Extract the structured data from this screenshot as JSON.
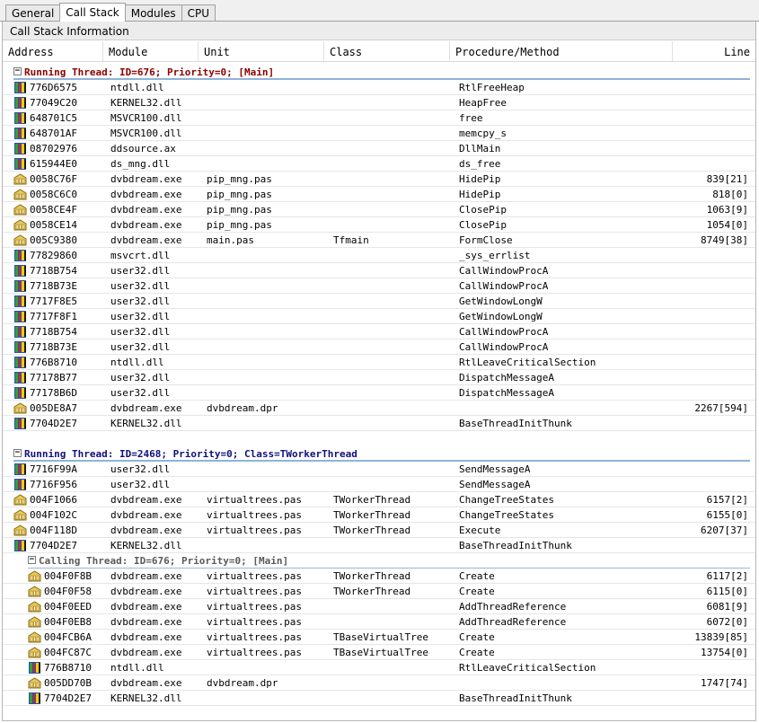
{
  "tabs": [
    {
      "label": "General",
      "active": false
    },
    {
      "label": "Call Stack",
      "active": true
    },
    {
      "label": "Modules",
      "active": false
    },
    {
      "label": "CPU",
      "active": false
    }
  ],
  "caption": "Call Stack Information",
  "columns": {
    "address": "Address",
    "module": "Module",
    "unit": "Unit",
    "class": "Class",
    "procedure": "Procedure/Method",
    "line": "Line"
  },
  "threads": [
    {
      "title": "Running Thread: ID=676; Priority=0; [Main]",
      "style": "t1",
      "rows": [
        {
          "address": "776D6575",
          "module": "ntdll.dll",
          "unit": "",
          "class": "",
          "procedure": "RtlFreeHeap",
          "line": "",
          "icon": "module-icon"
        },
        {
          "address": "77049C20",
          "module": "KERNEL32.dll",
          "unit": "",
          "class": "",
          "procedure": "HeapFree",
          "line": "",
          "icon": "module-icon"
        },
        {
          "address": "648701C5",
          "module": "MSVCR100.dll",
          "unit": "",
          "class": "",
          "procedure": "free",
          "line": "",
          "icon": "module-icon"
        },
        {
          "address": "648701AF",
          "module": "MSVCR100.dll",
          "unit": "",
          "class": "",
          "procedure": "memcpy_s",
          "line": "",
          "icon": "module-icon"
        },
        {
          "address": "08702976",
          "module": "ddsource.ax",
          "unit": "",
          "class": "",
          "procedure": "DllMain",
          "line": "",
          "icon": "module-icon"
        },
        {
          "address": "615944E0",
          "module": "ds_mng.dll",
          "unit": "",
          "class": "",
          "procedure": "ds_free",
          "line": "",
          "icon": "module-icon"
        },
        {
          "address": "0058C76F",
          "module": "dvbdream.exe",
          "unit": "pip_mng.pas",
          "class": "",
          "procedure": "HidePip",
          "line": "839[21]",
          "icon": "source-icon"
        },
        {
          "address": "0058C6C0",
          "module": "dvbdream.exe",
          "unit": "pip_mng.pas",
          "class": "",
          "procedure": "HidePip",
          "line": "818[0]",
          "icon": "source-icon"
        },
        {
          "address": "0058CE4F",
          "module": "dvbdream.exe",
          "unit": "pip_mng.pas",
          "class": "",
          "procedure": "ClosePip",
          "line": "1063[9]",
          "icon": "source-icon"
        },
        {
          "address": "0058CE14",
          "module": "dvbdream.exe",
          "unit": "pip_mng.pas",
          "class": "",
          "procedure": "ClosePip",
          "line": "1054[0]",
          "icon": "source-icon"
        },
        {
          "address": "005C9380",
          "module": "dvbdream.exe",
          "unit": "main.pas",
          "class": "Tfmain",
          "procedure": "FormClose",
          "line": "8749[38]",
          "icon": "source-icon"
        },
        {
          "address": "77829860",
          "module": "msvcrt.dll",
          "unit": "",
          "class": "",
          "procedure": "_sys_errlist",
          "line": "",
          "icon": "module-icon"
        },
        {
          "address": "7718B754",
          "module": "user32.dll",
          "unit": "",
          "class": "",
          "procedure": "CallWindowProcA",
          "line": "",
          "icon": "module-icon"
        },
        {
          "address": "7718B73E",
          "module": "user32.dll",
          "unit": "",
          "class": "",
          "procedure": "CallWindowProcA",
          "line": "",
          "icon": "module-icon"
        },
        {
          "address": "7717F8E5",
          "module": "user32.dll",
          "unit": "",
          "class": "",
          "procedure": "GetWindowLongW",
          "line": "",
          "icon": "module-icon"
        },
        {
          "address": "7717F8F1",
          "module": "user32.dll",
          "unit": "",
          "class": "",
          "procedure": "GetWindowLongW",
          "line": "",
          "icon": "module-icon"
        },
        {
          "address": "7718B754",
          "module": "user32.dll",
          "unit": "",
          "class": "",
          "procedure": "CallWindowProcA",
          "line": "",
          "icon": "module-icon"
        },
        {
          "address": "7718B73E",
          "module": "user32.dll",
          "unit": "",
          "class": "",
          "procedure": "CallWindowProcA",
          "line": "",
          "icon": "module-icon"
        },
        {
          "address": "776B8710",
          "module": "ntdll.dll",
          "unit": "",
          "class": "",
          "procedure": "RtlLeaveCriticalSection",
          "line": "",
          "icon": "module-icon"
        },
        {
          "address": "77178B77",
          "module": "user32.dll",
          "unit": "",
          "class": "",
          "procedure": "DispatchMessageA",
          "line": "",
          "icon": "module-icon"
        },
        {
          "address": "77178B6D",
          "module": "user32.dll",
          "unit": "",
          "class": "",
          "procedure": "DispatchMessageA",
          "line": "",
          "icon": "module-icon"
        },
        {
          "address": "005DE8A7",
          "module": "dvbdream.exe",
          "unit": "dvbdream.dpr",
          "class": "",
          "procedure": "",
          "line": "2267[594]",
          "icon": "source-icon"
        },
        {
          "address": "7704D2E7",
          "module": "KERNEL32.dll",
          "unit": "",
          "class": "",
          "procedure": "BaseThreadInitThunk",
          "line": "",
          "icon": "module-icon"
        }
      ]
    },
    {
      "title": "Running Thread: ID=2468; Priority=0; Class=TWorkerThread",
      "style": "t2",
      "rows": [
        {
          "address": "7716F99A",
          "module": "user32.dll",
          "unit": "",
          "class": "",
          "procedure": "SendMessageA",
          "line": "",
          "icon": "module-icon"
        },
        {
          "address": "7716F956",
          "module": "user32.dll",
          "unit": "",
          "class": "",
          "procedure": "SendMessageA",
          "line": "",
          "icon": "module-icon"
        },
        {
          "address": "004F1066",
          "module": "dvbdream.exe",
          "unit": "virtualtrees.pas",
          "class": "TWorkerThread",
          "procedure": "ChangeTreeStates",
          "line": "6157[2]",
          "icon": "source-icon"
        },
        {
          "address": "004F102C",
          "module": "dvbdream.exe",
          "unit": "virtualtrees.pas",
          "class": "TWorkerThread",
          "procedure": "ChangeTreeStates",
          "line": "6155[0]",
          "icon": "source-icon"
        },
        {
          "address": "004F118D",
          "module": "dvbdream.exe",
          "unit": "virtualtrees.pas",
          "class": "TWorkerThread",
          "procedure": "Execute",
          "line": "6207[37]",
          "icon": "source-icon"
        },
        {
          "address": "7704D2E7",
          "module": "KERNEL32.dll",
          "unit": "",
          "class": "",
          "procedure": "BaseThreadInitThunk",
          "line": "",
          "icon": "module-icon"
        }
      ],
      "calling": {
        "title": "Calling Thread: ID=676; Priority=0; [Main]",
        "rows": [
          {
            "address": "004F0F8B",
            "module": "dvbdream.exe",
            "unit": "virtualtrees.pas",
            "class": "TWorkerThread",
            "procedure": "Create",
            "line": "6117[2]",
            "icon": "source-icon"
          },
          {
            "address": "004F0F58",
            "module": "dvbdream.exe",
            "unit": "virtualtrees.pas",
            "class": "TWorkerThread",
            "procedure": "Create",
            "line": "6115[0]",
            "icon": "source-icon"
          },
          {
            "address": "004F0EED",
            "module": "dvbdream.exe",
            "unit": "virtualtrees.pas",
            "class": "",
            "procedure": "AddThreadReference",
            "line": "6081[9]",
            "icon": "source-icon"
          },
          {
            "address": "004F0EB8",
            "module": "dvbdream.exe",
            "unit": "virtualtrees.pas",
            "class": "",
            "procedure": "AddThreadReference",
            "line": "6072[0]",
            "icon": "source-icon"
          },
          {
            "address": "004FCB6A",
            "module": "dvbdream.exe",
            "unit": "virtualtrees.pas",
            "class": "TBaseVirtualTree",
            "procedure": "Create",
            "line": "13839[85]",
            "icon": "source-icon"
          },
          {
            "address": "004FC87C",
            "module": "dvbdream.exe",
            "unit": "virtualtrees.pas",
            "class": "TBaseVirtualTree",
            "procedure": "Create",
            "line": "13754[0]",
            "icon": "source-icon"
          },
          {
            "address": "776B8710",
            "module": "ntdll.dll",
            "unit": "",
            "class": "",
            "procedure": "RtlLeaveCriticalSection",
            "line": "",
            "icon": "module-icon"
          },
          {
            "address": "005DD70B",
            "module": "dvbdream.exe",
            "unit": "dvbdream.dpr",
            "class": "",
            "procedure": "",
            "line": "1747[74]",
            "icon": "source-icon"
          },
          {
            "address": "7704D2E7",
            "module": "KERNEL32.dll",
            "unit": "",
            "class": "",
            "procedure": "BaseThreadInitThunk",
            "line": "",
            "icon": "module-icon"
          }
        ]
      }
    }
  ]
}
